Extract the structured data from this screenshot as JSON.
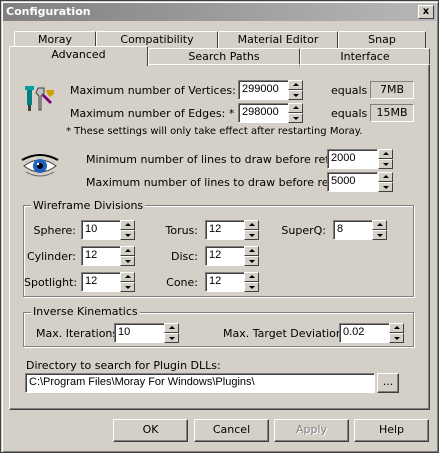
{
  "window": {
    "title": "Configuration",
    "close_glyph": "x"
  },
  "tabs": {
    "row1": [
      "Moray",
      "Compatibility",
      "Material Editor",
      "Snap"
    ],
    "row2": [
      "Advanced",
      "Search Paths",
      "Interface"
    ],
    "active": "Advanced"
  },
  "limits": {
    "icon": "wrench-tools-icon",
    "vertices_label": "Maximum number of Vertices: *",
    "vertices_value": "299000",
    "vertices_equals": "equals",
    "vertices_mem": "7MB",
    "edges_label": "Maximum number of Edges: *",
    "edges_value": "298000",
    "edges_equals": "equals",
    "edges_mem": "15MB",
    "note": "* These settings will only take effect after restarting Moray."
  },
  "refresh": {
    "icon": "eye-icon",
    "min_label": "Minimum number of lines to draw before refreshing:",
    "min_value": "2000",
    "max_label": "Maximum number of lines to draw before refreshing:",
    "max_value": "5000"
  },
  "wireframe": {
    "title": "Wireframe Divisions",
    "sphere_label": "Sphere:",
    "sphere_value": "10",
    "torus_label": "Torus:",
    "torus_value": "12",
    "superq_label": "SuperQ:",
    "superq_value": "8",
    "cylinder_label": "Cylinder:",
    "cylinder_value": "12",
    "disc_label": "Disc:",
    "disc_value": "12",
    "spotlight_label": "Spotlight:",
    "spotlight_value": "12",
    "cone_label": "Cone:",
    "cone_value": "12"
  },
  "ik": {
    "title": "Inverse Kinematics",
    "iter_label": "Max. Iterations:",
    "iter_value": "10",
    "dev_label": "Max. Target Deviation:",
    "dev_value": "0.02"
  },
  "plugins": {
    "label": "Directory to search for Plugin DLLs:",
    "path": "C:\\Program Files\\Moray For Windows\\Plugins\\",
    "browse": "..."
  },
  "buttons": {
    "ok": "OK",
    "cancel": "Cancel",
    "apply": "Apply",
    "help": "Help"
  }
}
